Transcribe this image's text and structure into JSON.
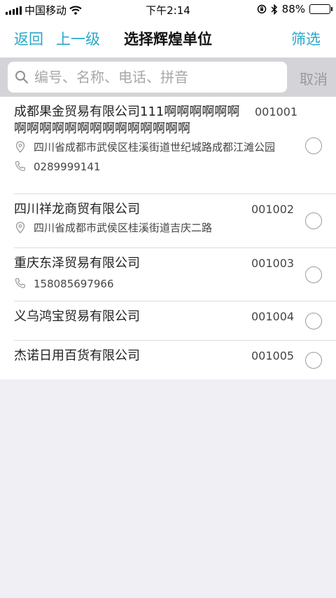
{
  "status": {
    "carrier": "中国移动",
    "time": "下午2:14",
    "battery": "88%",
    "battery_level": 0.88
  },
  "nav": {
    "back": "返回",
    "up": "上一级",
    "title": "选择辉煌单位",
    "filter": "筛选"
  },
  "search": {
    "placeholder": "编号、名称、电话、拼音",
    "cancel": "取消"
  },
  "items": [
    {
      "name": "成都果金贸易有限公司111啊啊啊啊啊啊啊啊啊啊啊啊啊啊啊啊啊啊啊啊",
      "code": "001001",
      "address": "四川省成都市武侯区桂溪街道世纪城路成都江滩公园",
      "phone": "0289999141"
    },
    {
      "name": "四川祥龙商贸有限公司",
      "code": "001002",
      "address": "四川省成都市武侯区桂溪街道吉庆二路",
      "phone": ""
    },
    {
      "name": "重庆东泽贸易有限公司",
      "code": "001003",
      "address": "",
      "phone": "158085697966"
    },
    {
      "name": "义乌鸿宝贸易有限公司",
      "code": "001004",
      "address": "",
      "phone": ""
    },
    {
      "name": "杰诺日用百货有限公司",
      "code": "001005",
      "address": "",
      "phone": ""
    }
  ],
  "colors": {
    "accent": "#2aa7c9",
    "search_bg": "#d4d4d8",
    "page_bg": "#efeff4"
  }
}
